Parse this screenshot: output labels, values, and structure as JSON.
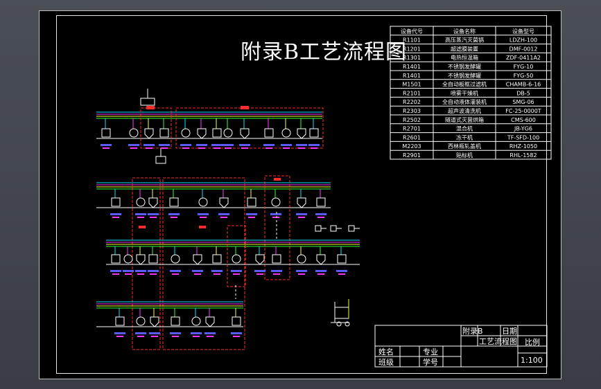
{
  "title": "附录B工艺流程图",
  "equipment_table": {
    "headers": [
      "设备代号",
      "设备名称",
      "设备型号"
    ],
    "rows": [
      [
        "R1101",
        "高压蒸汽灭菌锅",
        "LDZH-100"
      ],
      [
        "R1201",
        "超滤膜装置",
        "DMF-0012"
      ],
      [
        "R1301",
        "电热恒温箱",
        "ZDF-0411A2"
      ],
      [
        "R1401",
        "不锈钢发酵罐",
        "FYG-10"
      ],
      [
        "R1401",
        "不锈钢发酵罐",
        "FYG-50"
      ],
      [
        "M1501",
        "全自动板框过滤机",
        "CHAMB-6-16"
      ],
      [
        "R2101",
        "喷雾干燥机",
        "DB-5"
      ],
      [
        "R2202",
        "全自动液体灌装机",
        "SMG-06"
      ],
      [
        "R2303",
        "超声波清洗机",
        "FC-25-0000T"
      ],
      [
        "R2502",
        "隧道式灭菌烘箱",
        "CMS-600"
      ],
      [
        "R2701",
        "混合机",
        "JB-YG6"
      ],
      [
        "R2601",
        "冻干机",
        "TF-SFD-100"
      ],
      [
        "M2203",
        "西林瓶轧盖机",
        "RHZ-1050"
      ],
      [
        "R2901",
        "贴标机",
        "RHL-1582"
      ]
    ]
  },
  "title_block": {
    "drawing_name": "附录B",
    "date_label": "日期",
    "subtitle": "工艺流程图",
    "scale_label": "比例",
    "scale_value": "1:100",
    "name_label": "姓名",
    "class_label": "班级",
    "major_label": "专业",
    "student_id_label": "学号"
  },
  "colors": {
    "background": "#000000",
    "frame": "#e8e8e8",
    "text": "#ffffff",
    "boundary": "#ff2a2a",
    "pipe_cyan": "#00e5ff",
    "pipe_magenta": "#ff33ff",
    "pipe_yellow": "#ffff33",
    "pipe_green": "#33ff33"
  }
}
